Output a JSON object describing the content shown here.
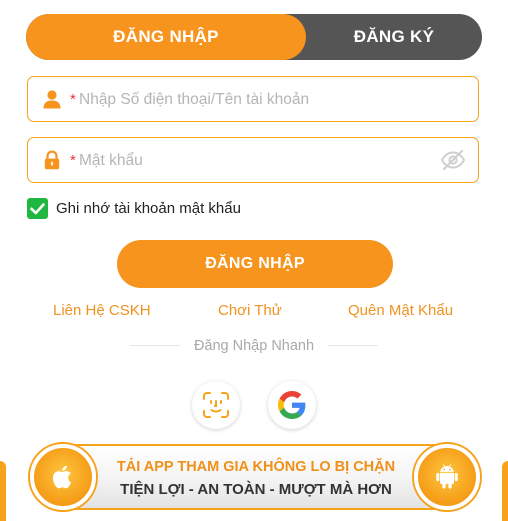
{
  "tabs": {
    "login": "ĐĂNG NHẬP",
    "register": "ĐĂNG KÝ"
  },
  "form": {
    "required_mark": "*",
    "username": {
      "placeholder": "Nhập Số điện thoại/Tên tài khoản",
      "value": "",
      "icon": "user-icon"
    },
    "password": {
      "placeholder": "Mật khẩu",
      "value": "",
      "icon": "lock-icon",
      "toggle_icon": "eye-off-icon"
    },
    "remember": {
      "label": "Ghi nhớ tài khoản mật khẩu",
      "checked": true
    },
    "submit_label": "ĐĂNG NHẬP"
  },
  "links": {
    "support": "Liên Hệ CSKH",
    "try": "Chơi Thử",
    "forgot": "Quên Mật Khẩu"
  },
  "quick_login": {
    "label": "Đăng Nhập Nhanh",
    "options": [
      "face-id-icon",
      "google-icon"
    ]
  },
  "banner": {
    "line1": "TẢI APP THAM GIA KHÔNG LO BỊ CHẶN",
    "line2": "TIỆN LỢI - AN TOÀN - MƯỢT MÀ HƠN",
    "left_icon": "apple-icon",
    "right_icon": "android-icon"
  },
  "colors": {
    "accent": "#f7941d",
    "inactive_tab": "#555555",
    "checkbox": "#1fb73f",
    "required": "#e53935",
    "link": "#f0921f"
  }
}
